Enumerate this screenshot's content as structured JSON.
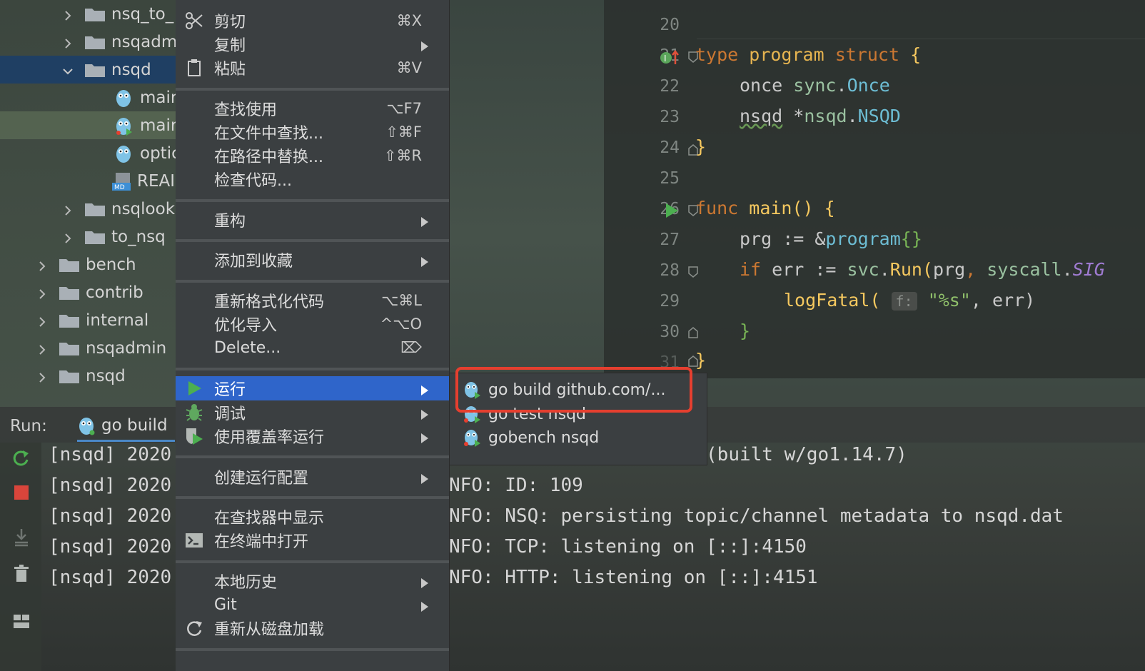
{
  "project_tree": {
    "rows": [
      {
        "label": "nsq_to_",
        "type": "folder",
        "expanded": false
      },
      {
        "label": "nsqadm",
        "type": "folder",
        "expanded": false
      },
      {
        "label": "nsqd",
        "type": "folder",
        "expanded": true,
        "selected": true
      },
      {
        "label": "mair",
        "type": "go-file"
      },
      {
        "label": "mair",
        "type": "go-test-file"
      },
      {
        "label": "optic",
        "type": "go-file"
      },
      {
        "label": "REAI",
        "type": "md-file"
      },
      {
        "label": "nsqlook",
        "type": "folder",
        "expanded": false
      },
      {
        "label": "to_nsq",
        "type": "folder",
        "expanded": false
      },
      {
        "label": "bench",
        "type": "folder",
        "expanded": false
      },
      {
        "label": "contrib",
        "type": "folder",
        "expanded": false
      },
      {
        "label": "internal",
        "type": "folder",
        "expanded": false
      },
      {
        "label": "nsqadmin",
        "type": "folder",
        "expanded": false
      },
      {
        "label": "nsqd",
        "type": "folder",
        "expanded": false
      }
    ]
  },
  "editor": {
    "line_numbers": [
      "20",
      "21",
      "22",
      "23",
      "24",
      "25",
      "26",
      "27",
      "28",
      "29",
      "30",
      "31"
    ],
    "code": {
      "l21": {
        "kw": "type",
        "name": "program",
        "kw2": "struct",
        "brace": "{"
      },
      "l22": {
        "field": "once",
        "pkg": "sync",
        "dot": ".",
        "type": "Once"
      },
      "l23": {
        "field": "nsqd",
        "star": "*",
        "pkg": "nsqd",
        "dot": ".",
        "type": "NSQD"
      },
      "l24": {
        "brace": "}"
      },
      "l26": {
        "kw": "func",
        "name": "main",
        "parens": "()",
        "brace": "{"
      },
      "l27": {
        "var": "prg",
        "op": " := &",
        "type": "program",
        "braces": "{}"
      },
      "l28": {
        "kw": "if",
        "var": "err",
        "op": " := ",
        "pkg": "svc",
        "dot": ".",
        "call": "Run",
        "open": "(",
        "arg1": "prg",
        ", ": ", ",
        "pkg2": "syscall",
        "dot2": ".",
        "const": "SIG"
      },
      "l29": {
        "call": "logFatal",
        "open": "(",
        "hint": "f:",
        "str": "\"%s\"",
        "rest": ", err)"
      },
      "l30": {
        "brace": "}"
      },
      "l31": {
        "brace": "}"
      }
    }
  },
  "run_panel": {
    "label": "Run:",
    "tab": "go build",
    "log_prefix": "[nsqd] 2020",
    "log_prefixes": [
      "[nsqd] 2020",
      "[nsqd] 2020",
      "[nsqd] 2020",
      "[nsqd] 2020",
      "[nsqd] 2020"
    ],
    "log_tails": [
      "NFO: nsqd v1.2.1-alpha (built w/go1.14.7)",
      "NFO: ID: 109",
      "NFO: NSQ: persisting topic/channel metadata to nsqd.dat",
      "NFO: TCP: listening on [::]:4150",
      "NFO: HTTP: listening on [::]:4151"
    ]
  },
  "context_menu": {
    "items": [
      {
        "label": "剪切",
        "shortcut": "⌘X",
        "icon": "scissors-icon"
      },
      {
        "label": "复制",
        "submenu": true
      },
      {
        "label": "粘贴",
        "shortcut": "⌘V",
        "icon": "clipboard-icon"
      },
      {
        "label": "查找使用",
        "shortcut": "⌥F7"
      },
      {
        "label": "在文件中查找...",
        "shortcut": "⇧⌘F"
      },
      {
        "label": "在路径中替换...",
        "shortcut": "⇧⌘R"
      },
      {
        "label": "检查代码..."
      },
      {
        "label": "重构",
        "submenu": true
      },
      {
        "label": "添加到收藏",
        "submenu": true
      },
      {
        "label": "重新格式化代码",
        "shortcut": "⌥⌘L"
      },
      {
        "label": "优化导入",
        "shortcut": "^⌥O"
      },
      {
        "label": "Delete...",
        "shortcut": "⌦"
      },
      {
        "label": "运行",
        "submenu": true,
        "active": true,
        "icon": "run-icon"
      },
      {
        "label": "调试",
        "submenu": true,
        "icon": "debug-icon"
      },
      {
        "label": "使用覆盖率运行",
        "submenu": true,
        "icon": "coverage-icon"
      },
      {
        "label": "创建运行配置",
        "submenu": true
      },
      {
        "label": "在查找器中显示"
      },
      {
        "label": "在终端中打开",
        "icon": "terminal-icon"
      },
      {
        "label": "本地历史",
        "submenu": true
      },
      {
        "label": "Git",
        "submenu": true
      },
      {
        "label": "重新从磁盘加载",
        "icon": "reload-icon"
      }
    ]
  },
  "run_submenu": {
    "items": [
      {
        "label": "go build github.com/...",
        "highlighted": true
      },
      {
        "label": "go test nsqd"
      },
      {
        "label": "gobench nsqd"
      }
    ]
  },
  "colors": {
    "selection": "#1f3f63",
    "menu_active": "#2f65ca",
    "highlight_box": "#e53f2f",
    "keyword": "#cc7832",
    "type": "#e6b450",
    "string": "#8fbf6a"
  }
}
